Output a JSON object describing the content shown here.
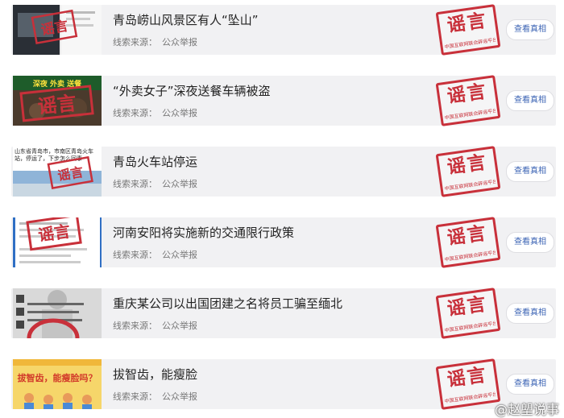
{
  "items": [
    {
      "title": "青岛崂山风景区有人“坠山”",
      "source_label": "线索来源：",
      "source_value": "公众举报",
      "button": "查看真相",
      "stamp_main": "谣言",
      "stamp_sub": "中国互联网联合辟谣平台"
    },
    {
      "title": "“外卖女子”深夜送餐车辆被盗",
      "source_label": "线索来源：",
      "source_value": "公众举报",
      "button": "查看真相",
      "stamp_main": "谣言",
      "stamp_sub": "中国互联网联合辟谣平台",
      "thumb_caption": "深夜 外卖 送餐"
    },
    {
      "title": "青岛火车站停运",
      "source_label": "线索来源：",
      "source_value": "公众举报",
      "button": "查看真相",
      "stamp_main": "谣言",
      "stamp_sub": "中国互联网联合辟谣平台",
      "thumb_caption": "山东省青岛市，市南区青岛火车站，停运了，下步怎么回事"
    },
    {
      "title": "河南安阳将实施新的交通限行政策",
      "source_label": "线索来源：",
      "source_value": "公众举报",
      "button": "查看真相",
      "stamp_main": "谣言",
      "stamp_sub": "中国互联网联合辟谣平台"
    },
    {
      "title": "重庆某公司以出国团建之名将员工骗至缅北",
      "source_label": "线索来源：",
      "source_value": "公众举报",
      "button": "查看真相",
      "stamp_main": "谣言",
      "stamp_sub": "中国互联网联合辟谣平台"
    },
    {
      "title": "拔智齿，能瘦脸",
      "source_label": "线索来源：",
      "source_value": "公众举报",
      "button": "查看真相",
      "stamp_main": "谣言",
      "stamp_sub": "中国互联网联合辟谣平台",
      "thumb_caption": "拔智齿，能瘦脸吗？"
    }
  ],
  "watermark": "@赵塱说事",
  "colors": {
    "accent": "#c8303a",
    "button_text": "#3c64b4",
    "card_bg": "#f1f1f3"
  }
}
